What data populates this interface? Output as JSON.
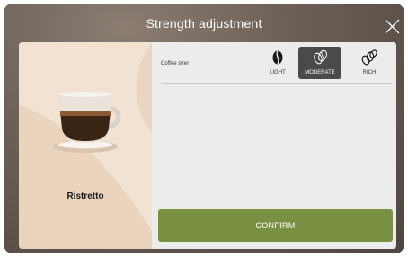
{
  "header": {
    "title": "Strength adjustment"
  },
  "drink": {
    "name": "Ristretto"
  },
  "strength": {
    "label": "Coffee strer",
    "options": [
      {
        "label": "LIGHT",
        "icon": "single-bean-icon",
        "selected": false
      },
      {
        "label": "MODERATE",
        "icon": "double-bean-icon",
        "selected": true
      },
      {
        "label": "RICH",
        "icon": "triple-bean-icon",
        "selected": false
      }
    ]
  },
  "actions": {
    "confirm_label": "CONFIRM"
  },
  "colors": {
    "accent": "#799042",
    "selected": "#4a4a4a",
    "left_panel": "#f2e2d2",
    "panel": "#ececec"
  }
}
